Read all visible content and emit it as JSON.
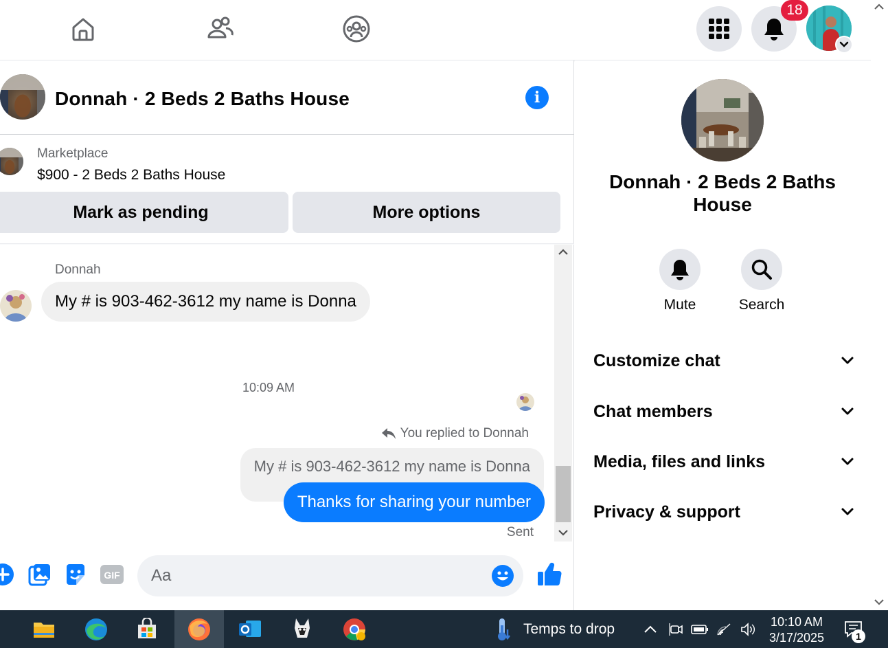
{
  "nav": {
    "notifications_count": "18"
  },
  "chat": {
    "title": "Donnah · 2 Beds 2 Baths House",
    "marketplace_label": "Marketplace",
    "marketplace_item": "$900 - 2 Beds 2 Baths House",
    "mark_pending_label": "Mark as pending",
    "more_options_label": "More options"
  },
  "messages": {
    "sender_name": "Donnah",
    "incoming_text": "My # is 903-462-3612 my name is Donna",
    "timestamp": "10:09 AM",
    "replied_label": "You replied to Donnah",
    "quoted_text": "My # is 903-462-3612 my name is Donna",
    "outgoing_text": "Thanks for sharing your number",
    "status": "Sent"
  },
  "composer": {
    "placeholder": "Aa"
  },
  "side": {
    "title": "Donnah · 2 Beds 2 Baths House",
    "mute_label": "Mute",
    "search_label": "Search",
    "sections": [
      "Customize chat",
      "Chat members",
      "Media, files and links",
      "Privacy & support"
    ]
  },
  "taskbar": {
    "weather_text": "Temps to drop",
    "time": "10:10 AM",
    "date": "3/17/2025",
    "notification_count": "1"
  },
  "colors": {
    "accent": "#0a7cff",
    "badge": "#e41e3f",
    "bubble_grey": "#f0f0f0",
    "button_grey": "#e4e6eb",
    "taskbar": "#1c2b38"
  },
  "icons": [
    "home-icon",
    "friends-icon",
    "groups-icon",
    "menu-grid-icon",
    "bell-icon",
    "info-icon",
    "plus-icon",
    "photo-icon",
    "sticker-icon",
    "gif-icon",
    "emoji-icon",
    "like-icon",
    "reply-arrow-icon",
    "search-icon",
    "chevron-down-icon"
  ]
}
